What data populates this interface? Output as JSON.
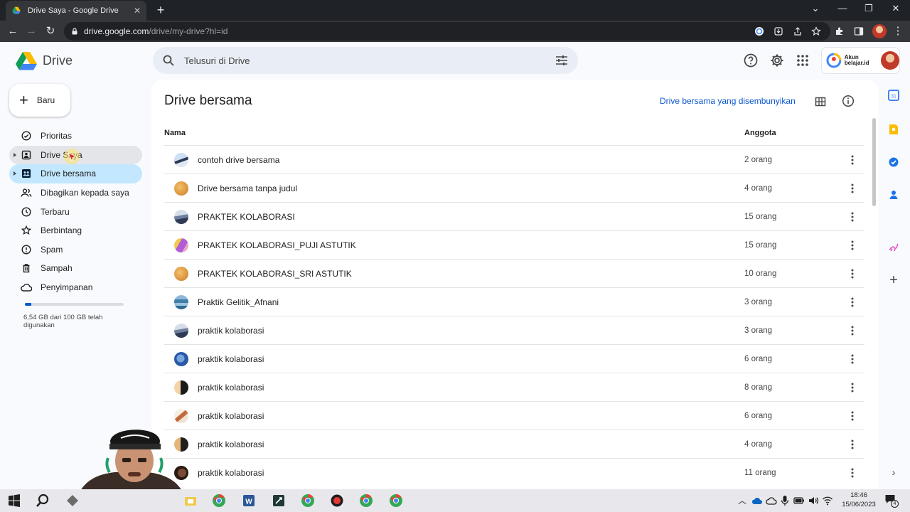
{
  "browser": {
    "tab_title": "Drive Saya - Google Drive",
    "url_host": "drive.google.com",
    "url_path": "/drive/my-drive?hl=id"
  },
  "header": {
    "logo_text": "Drive",
    "search_placeholder": "Telusuri di Drive",
    "account_label_line1": "Akun",
    "account_label_line2": "belajar.id"
  },
  "sidebar": {
    "new_button": "Baru",
    "items": [
      {
        "label": "Prioritas",
        "icon": "check-circle-icon"
      },
      {
        "label": "Drive Saya",
        "icon": "my-drive-icon"
      },
      {
        "label": "Drive bersama",
        "icon": "shared-drives-icon"
      },
      {
        "label": "Dibagikan kepada saya",
        "icon": "people-icon"
      },
      {
        "label": "Terbaru",
        "icon": "clock-icon"
      },
      {
        "label": "Berbintang",
        "icon": "star-icon"
      },
      {
        "label": "Spam",
        "icon": "spam-icon"
      },
      {
        "label": "Sampah",
        "icon": "trash-icon"
      },
      {
        "label": "Penyimpanan",
        "icon": "cloud-icon"
      }
    ],
    "storage_text": "6,54 GB dari 100 GB telah digunakan",
    "storage_used_fraction": 0.0654
  },
  "main": {
    "title": "Drive bersama",
    "hidden_link": "Drive bersama yang disembunyikan",
    "col_name": "Nama",
    "col_members": "Anggota",
    "rows": [
      {
        "name": "contoh drive bersama",
        "members": "2 orang"
      },
      {
        "name": "Drive bersama tanpa judul",
        "members": "4 orang"
      },
      {
        "name": "PRAKTEK KOLABORASI",
        "members": "15 orang"
      },
      {
        "name": "PRAKTEK KOLABORASI_PUJI ASTUTIK",
        "members": "15 orang"
      },
      {
        "name": "PRAKTEK KOLABORASI_SRI ASTUTIK",
        "members": "10 orang"
      },
      {
        "name": "Praktik Gelitik_Afnani",
        "members": "3 orang"
      },
      {
        "name": "praktik kolaborasi",
        "members": "3 orang"
      },
      {
        "name": "praktik kolaborasi",
        "members": "6 orang"
      },
      {
        "name": "praktik kolaborasi",
        "members": "8 orang"
      },
      {
        "name": "praktik kolaborasi",
        "members": "6 orang"
      },
      {
        "name": "praktik kolaborasi",
        "members": "4 orang"
      },
      {
        "name": "praktik kolaborasi",
        "members": "11 orang"
      }
    ]
  },
  "taskbar": {
    "time": "18:46",
    "date": "15/06/2023",
    "notification_count": "4"
  },
  "colors": {
    "accent": "#0b57d0",
    "active_nav": "#c2e7ff",
    "search_bg": "#e9eef6"
  }
}
